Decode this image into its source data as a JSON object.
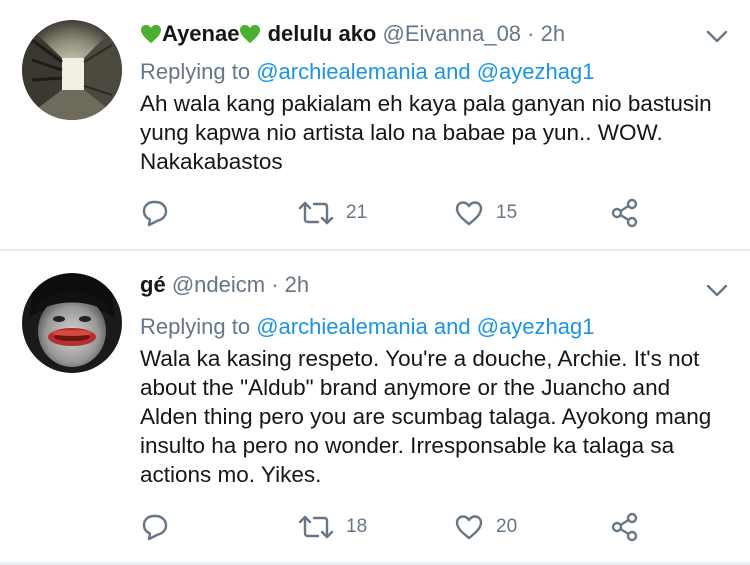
{
  "tweets": [
    {
      "display_name": "Ayenae",
      "display_name_suffix": "delulu ako",
      "handle": "@Eivanna_08",
      "separator": "·",
      "time": "2h",
      "replying_prefix": "Replying to",
      "replying_users": [
        "@archiealemania",
        "@ayezhag1"
      ],
      "replying_and": "and",
      "text": "Ah wala kang pakialam eh kaya pala ganyan nio bastusin\nyung kapwa nio artista lalo na babae pa yun.. WOW.\nNakakabastos",
      "retweets": "21",
      "likes": "15",
      "emoji_icon": "green-heart-icon"
    },
    {
      "display_name": "gé",
      "handle": "@ndeicm",
      "separator": "·",
      "time": "2h",
      "replying_prefix": "Replying to",
      "replying_users": [
        "@archiealemania",
        "@ayezhag1"
      ],
      "replying_and": "and",
      "text": "Wala ka kasing respeto. You're a douche, Archie. It's not\nabout the \"Aldub\" brand anymore or the Juancho and\nAlden thing pero you are scumbag talaga. Ayokong mang\ninsulto ha pero no wonder. Irresponsable ka talaga sa\nactions mo. Yikes.",
      "retweets": "18",
      "likes": "20"
    }
  ],
  "colors": {
    "text": "#14171a",
    "secondary": "#657786",
    "link": "#1b95e0",
    "divider": "#e6ecf0",
    "emoji_heart": "#4caf2f"
  },
  "icons": [
    "reply-icon",
    "retweet-icon",
    "like-icon",
    "share-icon",
    "chevron-down-icon"
  ]
}
